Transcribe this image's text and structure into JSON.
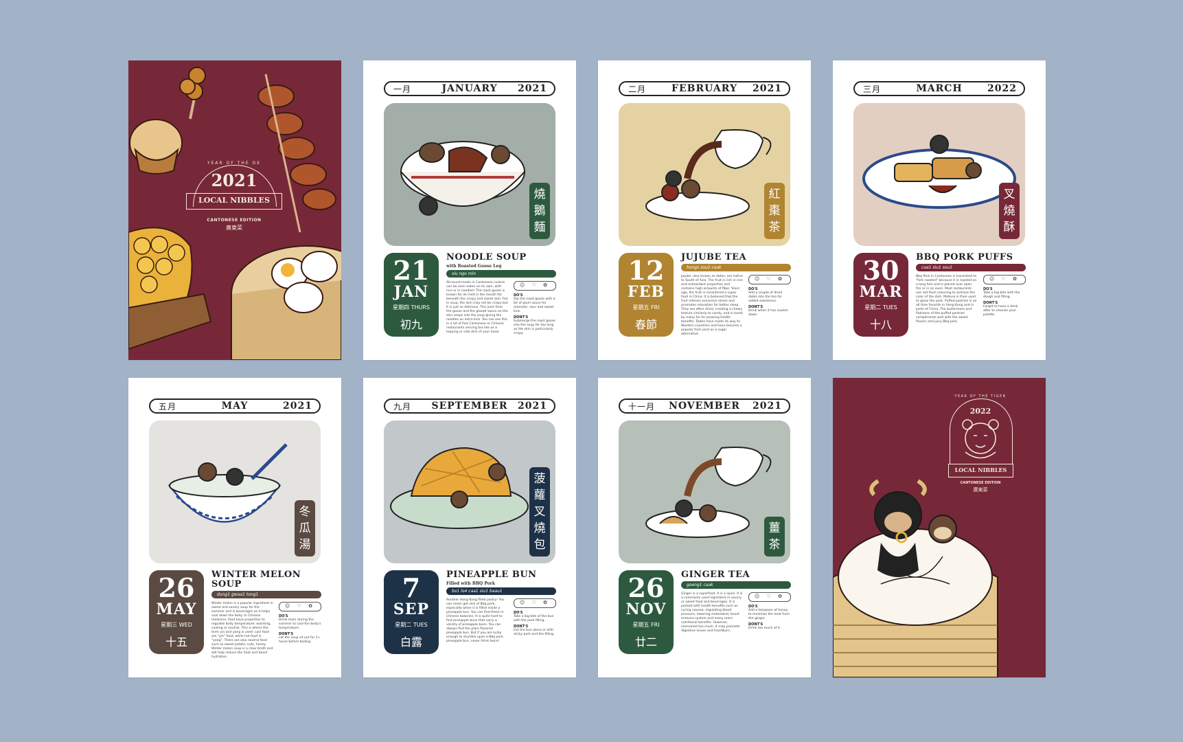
{
  "colors": {
    "background": "#a2b3c7",
    "maroon": "#762838",
    "green": "#2d5a3e",
    "gold": "#b08431",
    "brown": "#5a4a42",
    "navy": "#1e3247",
    "cream": "#f4e9dc"
  },
  "cover2021": {
    "arc_text": "YEAR OF THE OX",
    "year": "2021",
    "title": "LOCAL NIBBLES",
    "edition": "CANTONESE EDITION",
    "chinese": "廣東菜"
  },
  "cover2022": {
    "arc_text": "YEAR OF THE TIGER",
    "year": "2022",
    "title": "LOCAL NIBBLES",
    "edition": "CANTONESE EDITION",
    "chinese": "廣東菜"
  },
  "pages": [
    {
      "cn_month": "一月",
      "month": "JANUARY",
      "year": "2021",
      "day": "21",
      "mon": "JAN",
      "weekday": "星期四 THURS",
      "lunar": "初九",
      "dish": "NOODLE SOUP",
      "sub": "with Roasted Goose Leg",
      "romanization": "siu ngo mín",
      "vertical": [
        "燒",
        "鵝",
        "麵"
      ],
      "body": "All-round meals in Cantonese cuisine can be seen eaten on its own, with rice or in noodles! The roast goose is known for its melt in the mouth fat beneath the crispy and sweet skin. Put in soup, the skin may not be crispy but it is just as delicious. The juice from the goose and the glazed sauce on the skin seeps into the soup giving the noodles an extra kick. You can see this in a lot of fast Cantonese or Chinese restaurants serving tea like as a topping or side dish of your meal.",
      "dos": "Dip the roast goose with a bit of plum sauce for aromatic, sour and sweet kick.",
      "donts": "Submerge the roast goose into the soup for too long as the skin is particularly crispy.",
      "accent": "#2d5a3e"
    },
    {
      "cn_month": "二月",
      "month": "FEBRUARY",
      "year": "2021",
      "day": "12",
      "mon": "FEB",
      "weekday": "星期五 FRI",
      "lunar": "春節",
      "dish": "JUJUBE TEA",
      "sub": "",
      "romanization": "hongs zou2 caak",
      "vertical": [
        "紅",
        "棗",
        "茶"
      ],
      "body": "Jujube, also known as dates, are native to South of Asia. The fruit is rich in iron and antioxidant properties and contains high amounts of fiber. Years ago, the fruit is considered a super food in China. It is believed that the fruit relieves excessive stress and promotes relaxation for better sleep. They are often dried, creating a chewy texture similarly to candy, and is loved by many for its amazing health benefits. Dates have made its way to Western countries and have become a popular fruit used as a sugar alternative.",
      "dos": "Add a couple of dried dates into the tea for added sweetness.",
      "donts": "Drink when it has cooled down.",
      "accent": "#b08431"
    },
    {
      "cn_month": "三月",
      "month": "MARCH",
      "year": "2022",
      "day": "30",
      "mon": "MAR",
      "weekday": "星期二 TUES",
      "lunar": "十八",
      "dish": "BBQ PORK PUFFS",
      "sub": "",
      "romanization": "caa1 siu1 sou1",
      "vertical": [
        "叉",
        "燒",
        "酥"
      ],
      "body": "Bbq Pork in Cantonese is translated to \"fork roasted\" because it is roasted on a long fork and is placed over open fire or in an oven. Most restaurants use red food colouring to achieve the color of the dish. Mallose is then used to glaze the pork. Puffed pastries is an all time favorite in Hong Kong and in parts of China. The butteriness and flakiness of the puffed pastries compliments well with the sweet flavors and juicy Bbq pork.",
      "dos": "Take a big bite with the dough and filling.",
      "donts": "Forget to have a drink after to cleanse your palette.",
      "accent": "#762838"
    },
    {
      "cn_month": "五月",
      "month": "MAY",
      "year": "2021",
      "day": "26",
      "mon": "MAY",
      "weekday": "星期三 WED",
      "lunar": "十五",
      "dish": "WINTER MELON SOUP",
      "sub": "",
      "romanization": "dung1 gwaa1 tong1",
      "vertical": [
        "冬",
        "瓜",
        "湯"
      ],
      "body": "Winter melon is a popular ingredient in sweet and savory soup for the summer and in beverages as it helps cool down the body. In Chinese medicine, food have properties to regulate body temperature: warming, cooling or neutral. This is where the term yin and yang is used: cool food are \"yin\" food, while hot food is \"yang\". There are also neutral food such as sweet potato, nuts, honey. Winter melon soup is a clear broth and will help reduce the heat and boost hydration.",
      "dos": "Drink more during the summer to cool the body's temperature.",
      "donts": "Let the soup sit out for 2+ hours before boiling.",
      "accent": "#5a4a42"
    },
    {
      "cn_month": "九月",
      "month": "SEPTEMBER",
      "year": "2021",
      "day": "7",
      "mon": "SEP",
      "weekday": "星期二 TUES",
      "lunar": "白露",
      "dish": "PINEAPPLE BUN",
      "sub": "Filled with BBQ Pork",
      "romanization": "bo1 lo4 caa1 siu1 baau1",
      "vertical": [
        "菠",
        "蘿",
        "叉",
        "燒",
        "包"
      ],
      "body": "Another Hong Kong filled pastry! You can never get sick of Bbq pork, especially when it is filled inside a pineapple bun. You can find these in Chinese bakeries. It is quite hard to find pineapple buns that carry a variety of pineapple buns. You can always find the plain flavored pineapple bun. But if you are lucky enough to stumble upon a Bbq pork pineapple bun, never think twice!",
      "dos": "Take a big bite of the bun with the pork filling.",
      "donts": "Eat the bun alone or with sticky pork and the filling.",
      "accent": "#1e3247"
    },
    {
      "cn_month": "十一月",
      "month": "NOVEMBER",
      "year": "2021",
      "day": "26",
      "mon": "NOV",
      "weekday": "星期五 FRI",
      "lunar": "廿二",
      "dish": "GINGER TEA",
      "sub": "",
      "romanization": "goeng1 caak",
      "vertical": [
        "薑",
        "茶"
      ],
      "body": "Ginger is a superfood. It is a spice. It is a commonly used ingredient in savory or sweet food and beverages. It is packed with health benefits such as curing nausea, regulating blood pressure, lowering cholesterol, boost immune system and many more nutritional benefits. However, consumed too much, it may promote digestive issues and heartburn.",
      "dos": "Add a teaspoon of honey to minimize the heat from the ginger.",
      "donts": "Drink too much of it.",
      "accent": "#2d5a3e"
    }
  ],
  "labels": {
    "dos": "DO'S",
    "donts": "DONT'S",
    "icons": "☺ ♡ ✿"
  }
}
